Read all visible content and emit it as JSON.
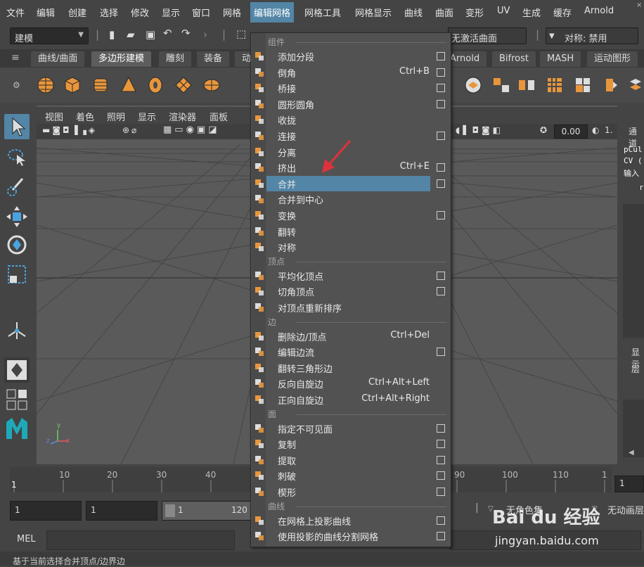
{
  "menubar": {
    "items": [
      "文件",
      "编辑",
      "创建",
      "选择",
      "修改",
      "显示",
      "窗口",
      "网格",
      "编辑网格",
      "网格工具",
      "网格显示",
      "曲线",
      "曲面",
      "变形",
      "UV",
      "生成",
      "缓存",
      "Arnold"
    ],
    "active_index": 8
  },
  "statusline": {
    "mode": "建模",
    "no_active_surface": "无激活曲面",
    "symmetry": "对称: 禁用"
  },
  "shelf_tabs": [
    "曲线/曲面",
    "多边形建模",
    "雕刻",
    "装备",
    "动",
    "Arnold",
    "Bifrost",
    "MASH",
    "运动图形"
  ],
  "shelf_active": 1,
  "viewport": {
    "menus": [
      "视图",
      "着色",
      "照明",
      "显示",
      "渲染器",
      "面板"
    ],
    "value": "0.00",
    "value2": "1.",
    "axis_x": "x",
    "axis_y": "y",
    "axis_z": "z"
  },
  "channel_box": {
    "title": "通道",
    "object": "pCul",
    "cv": "CV (",
    "inputs": "输入",
    "r": "r",
    "display": "显示",
    "layer": "层"
  },
  "timeline": {
    "ticks": [
      "1",
      "10",
      "20",
      "30",
      "40",
      "90",
      "100",
      "110",
      "1"
    ],
    "current_frame": "1"
  },
  "range": {
    "start": "1",
    "start2": "1",
    "slider_start": "1",
    "slider_end": "120",
    "no_character": "无角色集",
    "no_anim_layer": "无动画层"
  },
  "mel": {
    "label": "MEL"
  },
  "helpline": "基于当前选择合并顶点/边界边",
  "watermark": {
    "logo": "Bai du 经验",
    "url": "jingyan.baidu.com"
  },
  "dropdown": {
    "sections": [
      {
        "label": "组件",
        "items": [
          {
            "label": "添加分段",
            "shortcut": "",
            "option": true,
            "icon": "add-divisions-icon"
          },
          {
            "label": "倒角",
            "shortcut": "Ctrl+B",
            "option": true,
            "icon": "bevel-icon"
          },
          {
            "label": "桥接",
            "shortcut": "",
            "option": true,
            "icon": "bridge-icon"
          },
          {
            "label": "圆形圆角",
            "shortcut": "",
            "option": true,
            "icon": "circularize-icon"
          },
          {
            "label": "收拢",
            "shortcut": "",
            "option": false,
            "icon": "collapse-icon"
          },
          {
            "label": "连接",
            "shortcut": "",
            "option": true,
            "icon": "connect-icon"
          },
          {
            "label": "分离",
            "shortcut": "",
            "option": false,
            "icon": "detach-icon"
          },
          {
            "label": "挤出",
            "shortcut": "Ctrl+E",
            "option": true,
            "icon": "extrude-icon"
          },
          {
            "label": "合并",
            "shortcut": "",
            "option": true,
            "icon": "merge-icon",
            "highlighted": true
          },
          {
            "label": "合并到中心",
            "shortcut": "",
            "option": false,
            "icon": "merge-to-center-icon"
          },
          {
            "label": "变换",
            "shortcut": "",
            "option": true,
            "icon": "transform-icon"
          },
          {
            "label": "翻转",
            "shortcut": "",
            "option": false,
            "icon": "flip-icon"
          },
          {
            "label": "对称",
            "shortcut": "",
            "option": false,
            "icon": "symmetrize-icon"
          }
        ]
      },
      {
        "label": "顶点",
        "items": [
          {
            "label": "平均化顶点",
            "shortcut": "",
            "option": true,
            "icon": "average-vertices-icon"
          },
          {
            "label": "切角顶点",
            "shortcut": "",
            "option": true,
            "icon": "chamfer-vertices-icon"
          },
          {
            "label": "对顶点重新排序",
            "shortcut": "",
            "option": false,
            "icon": "reorder-vertices-icon"
          }
        ]
      },
      {
        "label": "边",
        "items": [
          {
            "label": "删除边/顶点",
            "shortcut": "Ctrl+Del",
            "option": false,
            "icon": "delete-edge-icon"
          },
          {
            "label": "编辑边流",
            "shortcut": "",
            "option": true,
            "icon": "edit-edge-flow-icon"
          },
          {
            "label": "翻转三角形边",
            "shortcut": "",
            "option": false,
            "icon": "flip-triangle-edge-icon"
          },
          {
            "label": "反向自旋边",
            "shortcut": "Ctrl+Alt+Left",
            "option": false,
            "icon": "spin-edge-backward-icon"
          },
          {
            "label": "正向自旋边",
            "shortcut": "Ctrl+Alt+Right",
            "option": false,
            "icon": "spin-edge-forward-icon"
          }
        ]
      },
      {
        "label": "面",
        "items": [
          {
            "label": "指定不可见面",
            "shortcut": "",
            "option": true,
            "icon": "assign-invisible-faces-icon"
          },
          {
            "label": "复制",
            "shortcut": "",
            "option": true,
            "icon": "duplicate-icon"
          },
          {
            "label": "提取",
            "shortcut": "",
            "option": true,
            "icon": "extract-icon"
          },
          {
            "label": "刺破",
            "shortcut": "",
            "option": true,
            "icon": "poke-icon"
          },
          {
            "label": "楔形",
            "shortcut": "",
            "option": true,
            "icon": "wedge-icon"
          }
        ]
      },
      {
        "label": "曲线",
        "items": [
          {
            "label": "在网格上投影曲线",
            "shortcut": "",
            "option": true,
            "icon": "project-curve-icon"
          },
          {
            "label": "使用投影的曲线分割网格",
            "shortcut": "",
            "option": true,
            "icon": "split-mesh-icon"
          }
        ]
      }
    ]
  },
  "colors": {
    "highlight": "#5285a6",
    "menu_bg": "#525252",
    "viewport_bg": "#5a5a5a",
    "arrow": "#e0323c",
    "shelf_icon": "#e8963c"
  }
}
